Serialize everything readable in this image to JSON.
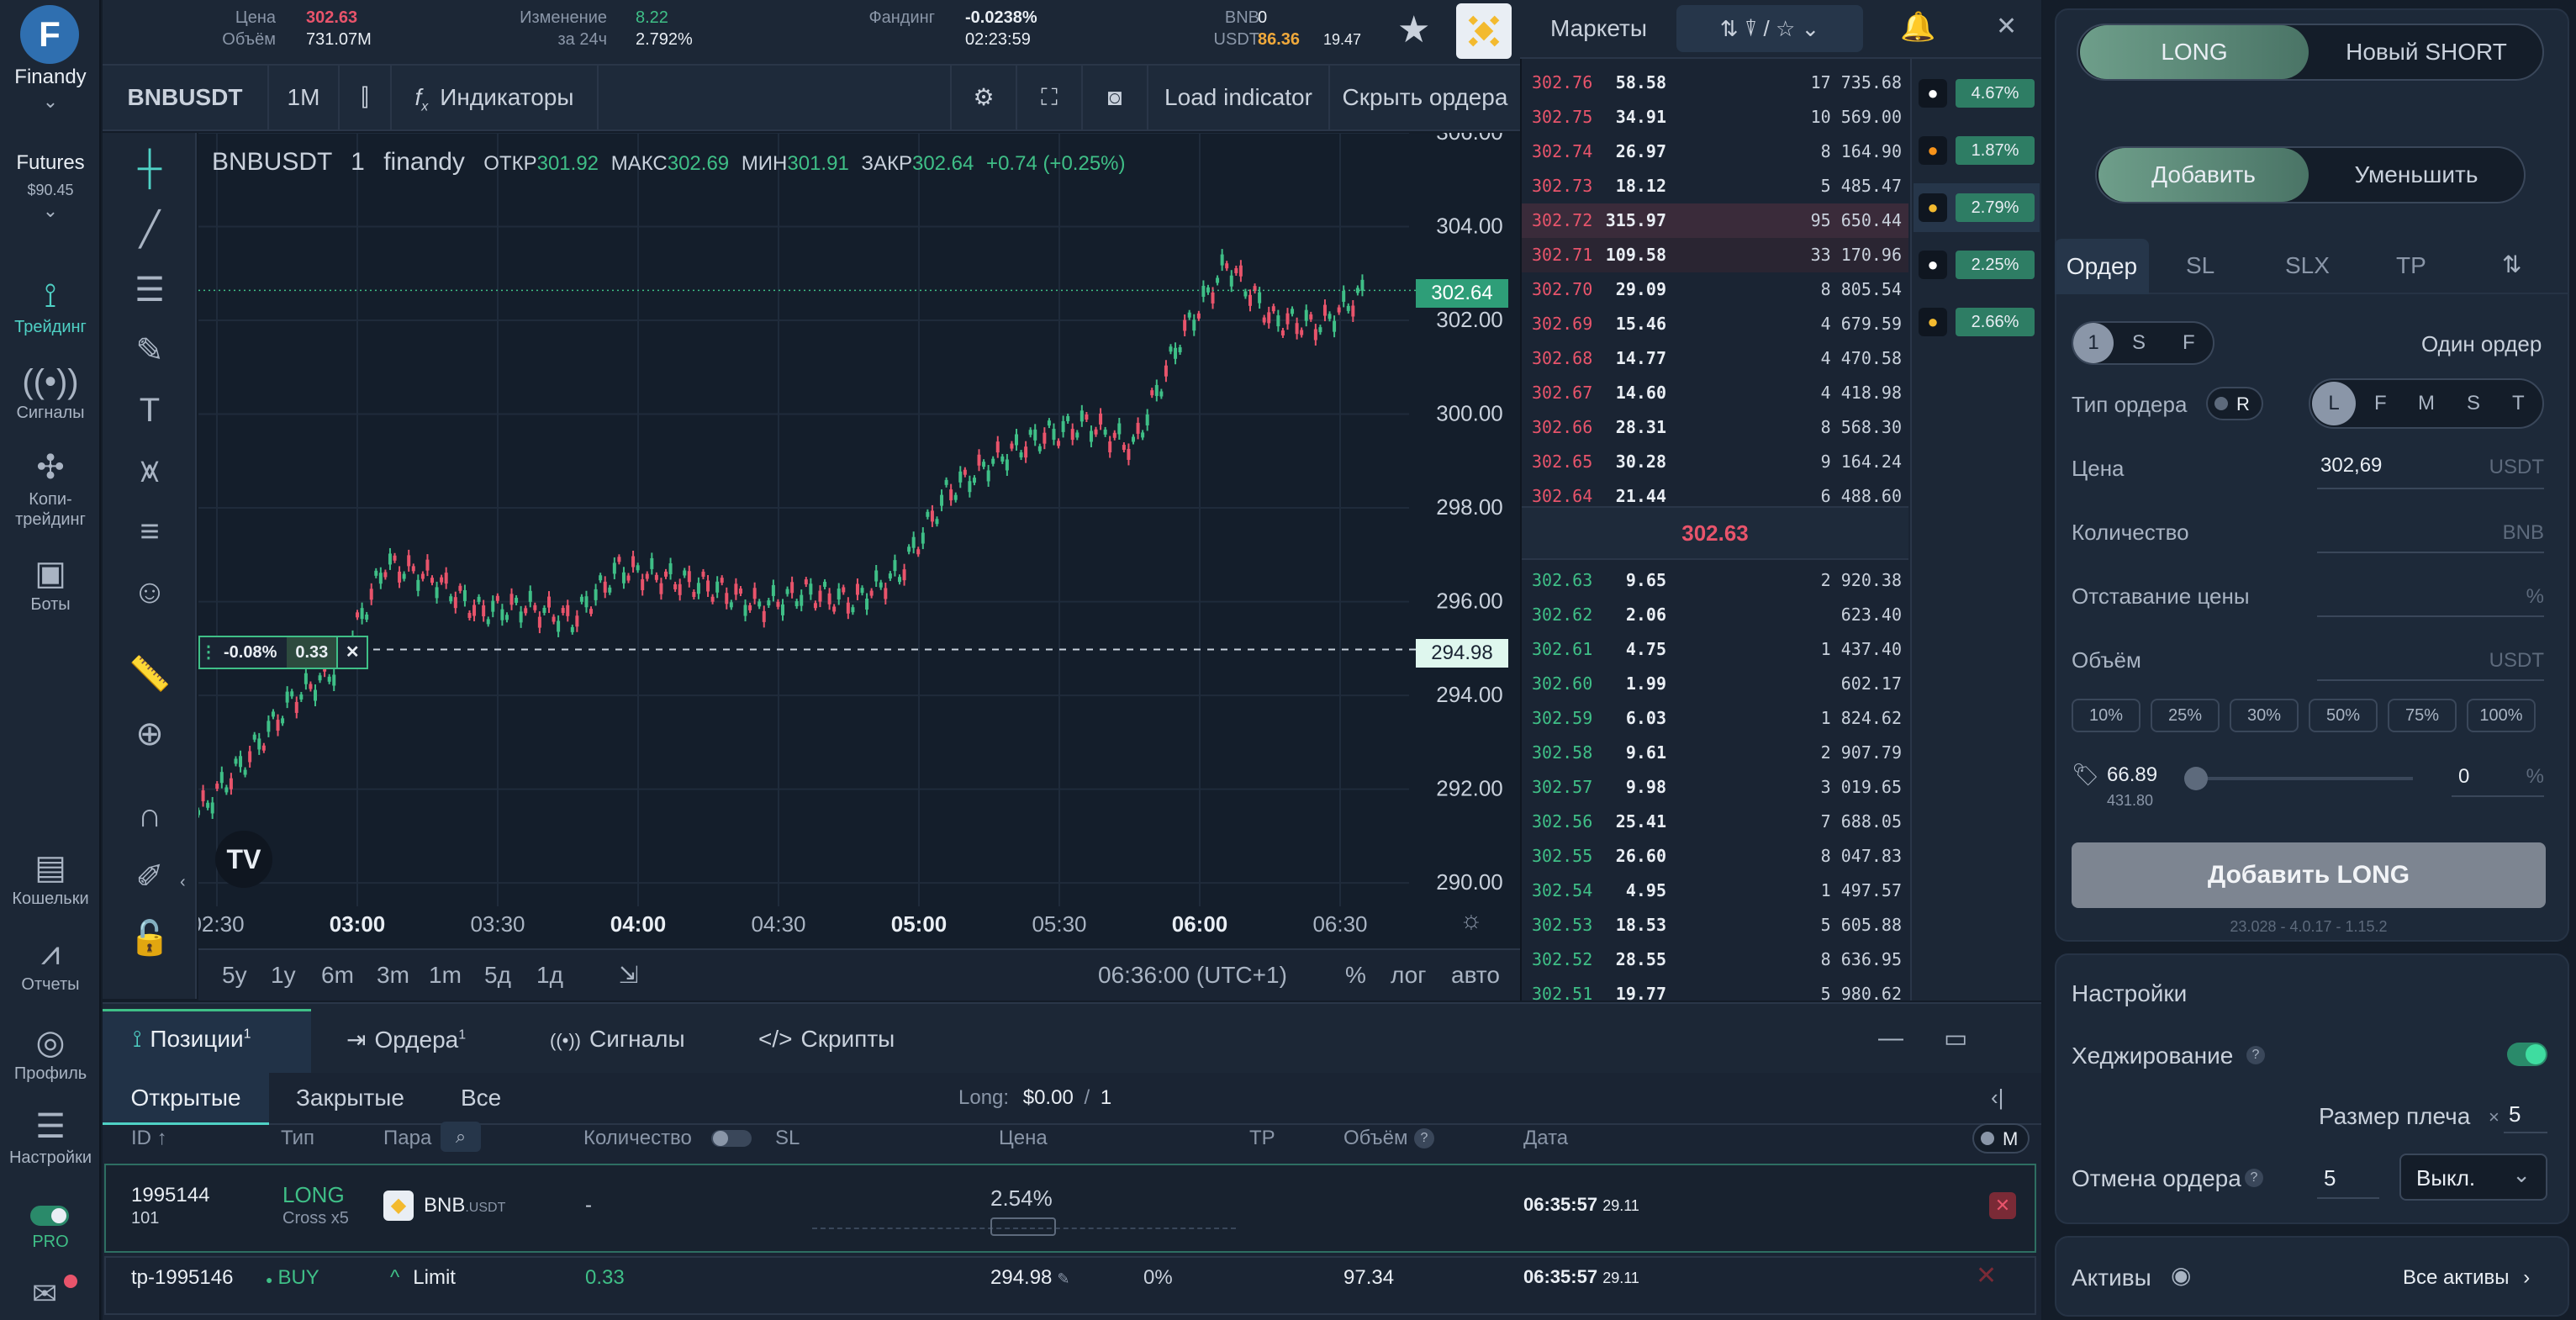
{
  "sidebar": {
    "brand": "Finandy",
    "futures_label": "Futures",
    "futures_balance": "$90.45",
    "items": [
      {
        "label": "Трейдинг",
        "icon": "trading-icon"
      },
      {
        "label": "Сигналы",
        "icon": "signals-icon"
      },
      {
        "label": "Копи-трейдинг",
        "icon": "copy-trading-icon"
      },
      {
        "label": "Боты",
        "icon": "bots-icon"
      },
      {
        "label": "Кошельки",
        "icon": "wallet-icon"
      },
      {
        "label": "Отчеты",
        "icon": "reports-icon"
      },
      {
        "label": "Профиль",
        "icon": "profile-icon"
      },
      {
        "label": "Настройки",
        "icon": "settings-icon"
      }
    ],
    "pro_label": "PRO"
  },
  "ticker": {
    "price_label": "Цена",
    "price": "302.63",
    "volume_label": "Объём",
    "volume": "731.07M",
    "change_label": "Изменение",
    "change_sub": "за 24ч",
    "change_value": "8.22",
    "change_pct": "2.792%",
    "funding_label": "Фандинг",
    "funding_rate": "-0.0238%",
    "funding_time": "02:23:59",
    "asset1": "BNB",
    "asset2": "USDT",
    "asset1_value": "0",
    "asset2_value": "86.36",
    "extra_value": "19.47"
  },
  "toolbar": {
    "symbol": "BNBUSDT",
    "interval": "1M",
    "indicators": "Индикаторы",
    "load_indicator": "Load indicator",
    "hide_orders": "Скрыть ордера"
  },
  "chart_legend": {
    "symbol": "BNBUSDT",
    "interval": "1",
    "source": "finandy",
    "open_label": "ОТКР",
    "open": "301.92",
    "high_label": "МАКС",
    "high": "302.69",
    "low_label": "МИН",
    "low": "301.91",
    "close_label": "ЗАКР",
    "close": "302.64",
    "change": "+0.74 (+0.25%)"
  },
  "order_line": {
    "pct": "-0.08%",
    "qty": "0.33",
    "price": "294.98"
  },
  "last_price_tag": "302.64",
  "chart_data": {
    "type": "line",
    "title": "",
    "xlabel": "",
    "ylabel": "",
    "x_ticks": [
      "02:30",
      "03:00",
      "03:30",
      "04:00",
      "04:30",
      "05:00",
      "05:30",
      "06:00",
      "06:30"
    ],
    "y_ticks": [
      "290.00",
      "292.00",
      "294.00",
      "296.00",
      "298.00",
      "300.00",
      "302.00",
      "304.00",
      "306.00"
    ],
    "ylim": [
      289.5,
      306
    ],
    "x": [
      "02:30",
      "02:40",
      "02:50",
      "03:00",
      "03:10",
      "03:20",
      "03:30",
      "03:40",
      "03:50",
      "04:00",
      "04:10",
      "04:20",
      "04:30",
      "04:40",
      "04:50",
      "05:00",
      "05:10",
      "05:20",
      "05:30",
      "05:40",
      "05:50",
      "06:00",
      "06:10",
      "06:20",
      "06:30",
      "06:36"
    ],
    "series": [
      {
        "values": [
          291.5,
          292.6,
          293.9,
          294.6,
          296.8,
          296.5,
          295.8,
          295.9,
          295.6,
          296.7,
          296.5,
          296.3,
          295.9,
          296.2,
          296.0,
          296.6,
          298.3,
          299.0,
          299.5,
          299.8,
          299.3,
          301.6,
          303.2,
          302.0,
          301.9,
          302.64
        ]
      }
    ],
    "bottom_periods": [
      "5y",
      "1y",
      "6m",
      "3m",
      "1m",
      "5д",
      "1д"
    ],
    "time_display": "06:36:00 (UTC+1)",
    "scale_options": [
      "%",
      "лог",
      "авто"
    ]
  },
  "orderbook": {
    "markets_label": "Маркеты",
    "asks": [
      [
        "302.76",
        "58.58",
        "17 735.68"
      ],
      [
        "302.75",
        "34.91",
        "10 569.00"
      ],
      [
        "302.74",
        "26.97",
        "8 164.90"
      ],
      [
        "302.73",
        "18.12",
        "5 485.47"
      ],
      [
        "302.72",
        "315.97",
        "95 650.44"
      ],
      [
        "302.71",
        "109.58",
        "33 170.96"
      ],
      [
        "302.70",
        "29.09",
        "8 805.54"
      ],
      [
        "302.69",
        "15.46",
        "4 679.59"
      ],
      [
        "302.68",
        "14.77",
        "4 470.58"
      ],
      [
        "302.67",
        "14.60",
        "4 418.98"
      ],
      [
        "302.66",
        "28.31",
        "8 568.30"
      ],
      [
        "302.65",
        "30.28",
        "9 164.24"
      ],
      [
        "302.64",
        "21.44",
        "6 488.60"
      ]
    ],
    "mid": "302.63",
    "bids": [
      [
        "302.63",
        "9.65",
        "2 920.38"
      ],
      [
        "302.62",
        "2.06",
        "623.40"
      ],
      [
        "302.61",
        "4.75",
        "1 437.40"
      ],
      [
        "302.60",
        "1.99",
        "602.17"
      ],
      [
        "302.59",
        "6.03",
        "1 824.62"
      ],
      [
        "302.58",
        "9.61",
        "2 907.79"
      ],
      [
        "302.57",
        "9.98",
        "3 019.65"
      ],
      [
        "302.56",
        "25.41",
        "7 688.05"
      ],
      [
        "302.55",
        "26.60",
        "8 047.83"
      ],
      [
        "302.54",
        "4.95",
        "1 497.57"
      ],
      [
        "302.53",
        "18.53",
        "5 605.88"
      ],
      [
        "302.52",
        "28.55",
        "8 636.95"
      ],
      [
        "302.51",
        "19.77",
        "5 980.62"
      ]
    ]
  },
  "markets": [
    {
      "pct": "4.67%",
      "icon": "market-coin-1-icon",
      "color": "#ffffff"
    },
    {
      "pct": "1.87%",
      "icon": "bitcoin-icon",
      "color": "#f7931a"
    },
    {
      "pct": "2.79%",
      "icon": "bnb-icon",
      "color": "#f3ba2f"
    },
    {
      "pct": "2.25%",
      "icon": "xrp-icon",
      "color": "#ffffff"
    },
    {
      "pct": "2.66%",
      "icon": "market-coin-5-icon",
      "color": "#f3ba2f"
    }
  ],
  "order_panel": {
    "long": "LONG",
    "short": "Новый SHORT",
    "add": "Добавить",
    "reduce": "Уменьшить",
    "tabs": [
      "Ордер",
      "SL",
      "SLX",
      "TP"
    ],
    "mode_selected": "1",
    "mode_s": "S",
    "mode_f": "F",
    "one_order": "Один ордер",
    "order_type_label": "Тип ордера",
    "order_type_r": "R",
    "types": [
      "L",
      "F",
      "M",
      "S",
      "T"
    ],
    "price_label": "Цена",
    "price_value": "302,69",
    "price_unit": "USDT",
    "qty_label": "Количество",
    "qty_unit": "BNB",
    "lag_label": "Отставание цены",
    "lag_unit": "%",
    "volume_label": "Объём",
    "volume_unit": "USDT",
    "pct_buttons": [
      "10%",
      "25%",
      "30%",
      "50%",
      "75%",
      "100%"
    ],
    "avail": "66.89",
    "avail_sub": "431.80",
    "slider_value": "0",
    "slider_unit": "%",
    "submit": "Добавить LONG",
    "version": "23.028 - 4.0.17 - 1.15.2"
  },
  "settings": {
    "title": "Настройки",
    "hedging": "Хеджирование",
    "leverage_label": "Размер плеча",
    "leverage_x": "×",
    "leverage": "5",
    "cancel_label": "Отмена ордера",
    "cancel_value": "5",
    "cancel_select": "Выкл.",
    "assets": "Активы",
    "all_assets": "Все активы"
  },
  "bottom": {
    "tabs": [
      {
        "label": "Позиции",
        "count": "1"
      },
      {
        "label": "Ордера",
        "count": "1"
      },
      {
        "label": "Сигналы",
        "count": ""
      },
      {
        "label": "Скрипты",
        "count": ""
      }
    ],
    "subtabs": [
      "Открытые",
      "Закрытые",
      "Все"
    ],
    "long_summary_label": "Long:",
    "long_summary_value": "$0.00",
    "long_summary_sep": "/",
    "long_summary_count": "1",
    "columns": [
      "ID ↑",
      "Тип",
      "Пара",
      "Количество",
      "SL",
      "Цена",
      "TP",
      "Объём",
      "Дата"
    ],
    "m_label": "M",
    "position": {
      "id": "1995144",
      "id_sub": "101",
      "type": "LONG",
      "type_sub": "Cross x5",
      "pair": "BNB",
      "pair_quote": ".USDT",
      "qty": "-",
      "pnl": "2.54%",
      "time": "06:35:57",
      "date": "29.11"
    },
    "order": {
      "id": "tp-1995146",
      "side": "BUY",
      "kind": "Limit",
      "qty": "0.33",
      "price": "294.98",
      "pct": "0%",
      "volume": "97.34",
      "time": "06:35:57",
      "date": "29.11"
    }
  }
}
